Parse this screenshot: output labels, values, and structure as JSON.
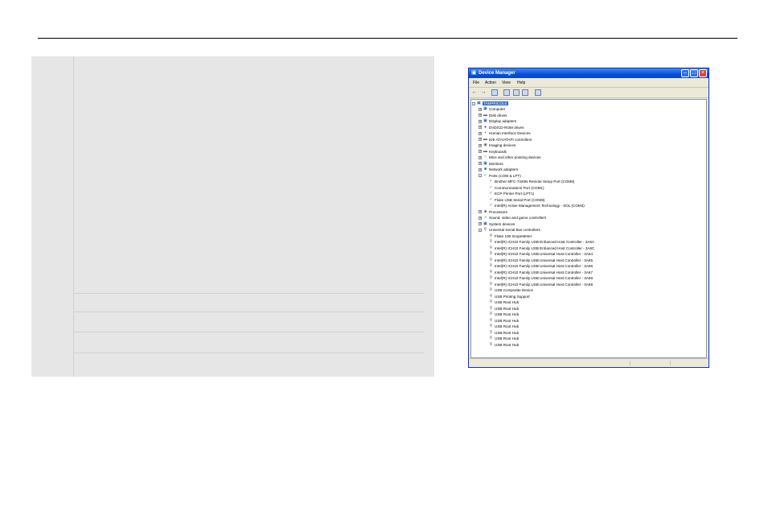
{
  "window": {
    "title": "Device Manager",
    "title_icon": "computer-icon",
    "controls": [
      "minimize",
      "maximize",
      "close"
    ]
  },
  "menu": [
    "File",
    "Action",
    "View",
    "Help"
  ],
  "toolbar": [
    "back-icon",
    "forward-icon",
    "properties-icon",
    "print-icon",
    "help-icon",
    "scan-icon",
    "update-driver-icon"
  ],
  "tree": {
    "root": "TAMPRICOLE",
    "categories": [
      "Computer",
      "Disk drives",
      "Display adapters",
      "DVD/CD-ROM drives",
      "Human Interface Devices",
      "IDE ATA/ATAPI controllers",
      "Imaging devices",
      "Keyboards",
      "Mice and other pointing devices",
      "Monitors",
      "Network adapters"
    ],
    "ports_label": "Ports (COM & LPT)",
    "ports": [
      "Brother MFC-7440N Remote Setup Port (COM9)",
      "Communications Port (COM1)",
      "ECP Printer Port (LPT1)",
      "Fluke USB Serial Port (COM8)",
      "Intel(R) Active Management Technology - SOL (COM3)"
    ],
    "categories2": [
      "Processors",
      "Sound, video and game controllers",
      "System devices"
    ],
    "usb_label": "Universal Serial Bus controllers",
    "usb": [
      "Fluke 190 ScopeMeter",
      "Intel(R) ICH10 Family USB Enhanced Host Controller - 3A6A",
      "Intel(R) ICH10 Family USB Enhanced Host Controller - 3A6C",
      "Intel(R) ICH10 Family USB Universal Host Controller - 3A64",
      "Intel(R) ICH10 Family USB Universal Host Controller - 3A65",
      "Intel(R) ICH10 Family USB Universal Host Controller - 3A66",
      "Intel(R) ICH10 Family USB Universal Host Controller - 3A67",
      "Intel(R) ICH10 Family USB Universal Host Controller - 3A68",
      "Intel(R) ICH10 Family USB Universal Host Controller - 3A69",
      "USB Composite Device",
      "USB Printing Support",
      "USB Root Hub",
      "USB Root Hub",
      "USB Root Hub",
      "USB Root Hub",
      "USB Root Hub",
      "USB Root Hub",
      "USB Root Hub",
      "USB Root Hub"
    ]
  }
}
